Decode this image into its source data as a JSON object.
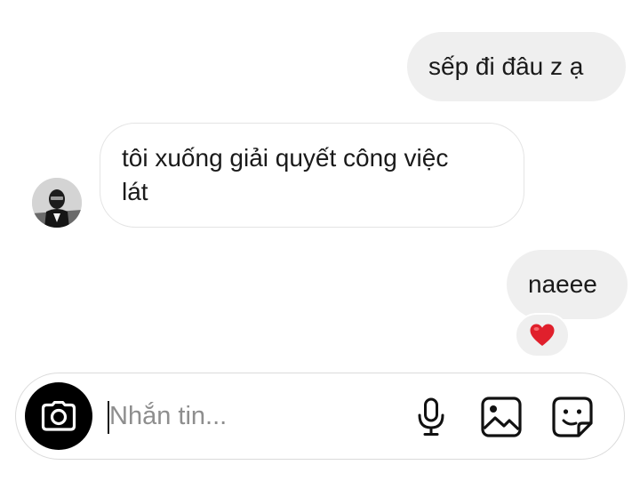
{
  "messages": [
    {
      "direction": "outgoing",
      "text": "sếp đi đâu z ạ"
    },
    {
      "direction": "incoming",
      "text_line1": "tôi xuống giải quyết công việc",
      "text_line2": "lát"
    },
    {
      "direction": "outgoing",
      "text": "naeee",
      "reaction": "❤️"
    }
  ],
  "composer": {
    "placeholder": "Nhắn tin..."
  },
  "icons": {
    "camera": "camera-icon",
    "mic": "microphone-icon",
    "gallery": "gallery-icon",
    "sticker": "sticker-icon",
    "reaction": "heart-icon"
  },
  "colors": {
    "outgoing_bubble": "#efefef",
    "incoming_border": "#e4e4e4",
    "camera_button": "#000000",
    "heart": "#e0202c",
    "placeholder": "#8e8e8e"
  }
}
